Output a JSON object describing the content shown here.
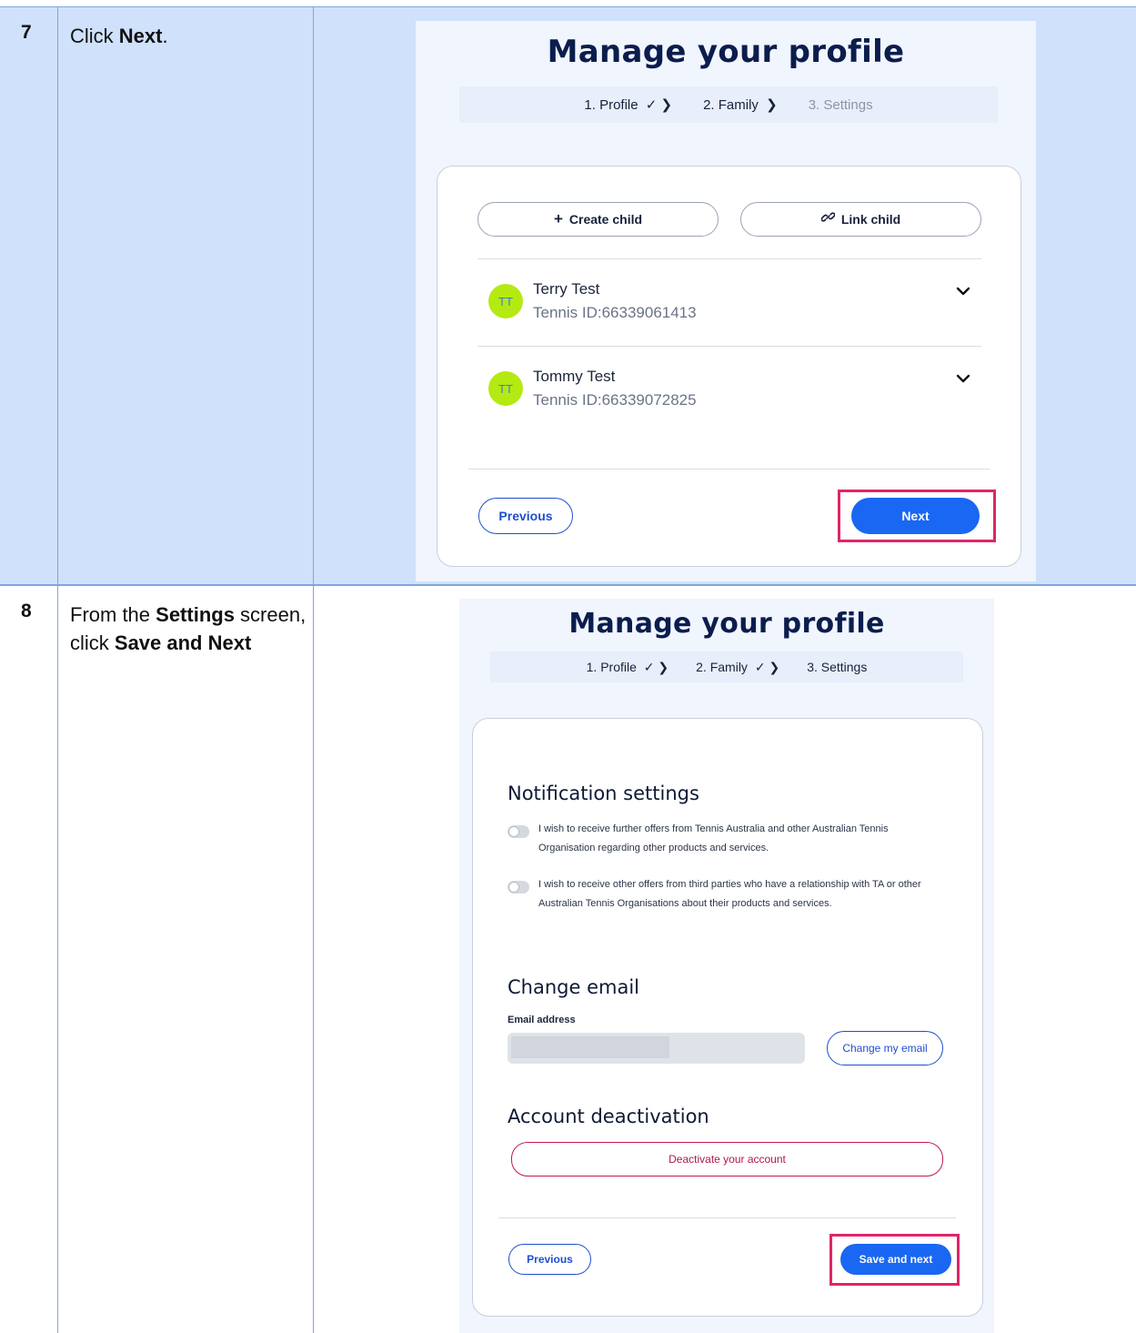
{
  "steps_table": [
    {
      "number": "7",
      "instruction": {
        "prefix": "Click ",
        "bold": "Next",
        "suffix": "."
      }
    },
    {
      "number": "8",
      "instruction": {
        "part1": "From the ",
        "bold1": "Settings",
        "part2": " screen, click ",
        "bold2": "Save and Next"
      }
    }
  ],
  "screen7": {
    "title": "Manage your profile",
    "steps": [
      {
        "label": "1.  Profile",
        "marker": "✓ ❯"
      },
      {
        "label": "2.  Family",
        "marker": "❯"
      },
      {
        "label": "3.  Settings",
        "marker": ""
      }
    ],
    "create_child": {
      "icon": "plus-icon",
      "label": "Create child"
    },
    "link_child": {
      "icon": "link-icon",
      "label": "Link child"
    },
    "children": [
      {
        "initials": "TT",
        "name": "Terry Test",
        "tennis_id": "Tennis ID:66339061413"
      },
      {
        "initials": "TT",
        "name": "Tommy Test",
        "tennis_id": "Tennis ID:66339072825"
      }
    ],
    "previous_label": "Previous",
    "next_label": "Next"
  },
  "screen8": {
    "title": "Manage your profile",
    "steps": [
      {
        "label": "1.  Profile",
        "marker": "✓ ❯"
      },
      {
        "label": "2.  Family",
        "marker": "✓ ❯"
      },
      {
        "label": "3.  Settings",
        "marker": ""
      }
    ],
    "notification_heading": "Notification settings",
    "toggles": [
      {
        "text": "I wish to receive further offers from Tennis Australia and other Australian Tennis Organisation regarding other products and services."
      },
      {
        "text": "I wish to receive other offers from third parties who have a relationship with TA or other Australian Tennis Organisations about their products and services."
      }
    ],
    "change_email_heading": "Change email",
    "email_label": "Email address",
    "change_email_button": "Change my email",
    "deactivation_heading": "Account deactivation",
    "deactivate_button": "Deactivate your account",
    "previous_label": "Previous",
    "save_next_label": "Save and next"
  },
  "colors": {
    "row_highlight": "#cfe1fb",
    "primary": "#1967f2",
    "callout": "#e0246a",
    "avatar": "#b4ea12",
    "danger": "#c2185b"
  }
}
